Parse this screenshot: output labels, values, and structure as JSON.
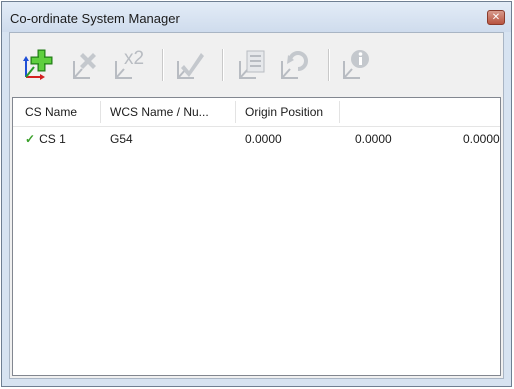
{
  "window": {
    "title": "Co-ordinate System Manager",
    "close_glyph": "✕"
  },
  "toolbar": {
    "buttons": [
      {
        "name": "add-cs-button",
        "icon": "add-coordinate-system-icon",
        "enabled": true
      },
      {
        "name": "delete-cs-button",
        "icon": "delete-coordinate-system-icon",
        "enabled": false
      },
      {
        "name": "duplicate-cs-button",
        "icon": "duplicate-coordinate-system-icon",
        "label": "x2",
        "enabled": false
      },
      {
        "name": "activate-cs-button",
        "icon": "activate-coordinate-system-icon",
        "enabled": false
      },
      {
        "name": "list-cs-button",
        "icon": "list-coordinate-system-icon",
        "enabled": false
      },
      {
        "name": "reset-cs-button",
        "icon": "reset-coordinate-system-icon",
        "enabled": false
      },
      {
        "name": "info-cs-button",
        "icon": "info-coordinate-system-icon",
        "enabled": false
      }
    ]
  },
  "grid": {
    "columns": [
      "CS Name",
      "WCS Name / Nu...",
      "Origin Position"
    ],
    "rows": [
      {
        "active": true,
        "cs_name": "CS 1",
        "wcs": "G54",
        "x": "0.0000",
        "y": "0.0000",
        "z": "0.0000"
      }
    ]
  },
  "colors": {
    "accent_green": "#3aa02a",
    "disabled_gray": "#b8bcc2",
    "axis_blue": "#1f4fd6",
    "axis_red": "#d42020"
  }
}
